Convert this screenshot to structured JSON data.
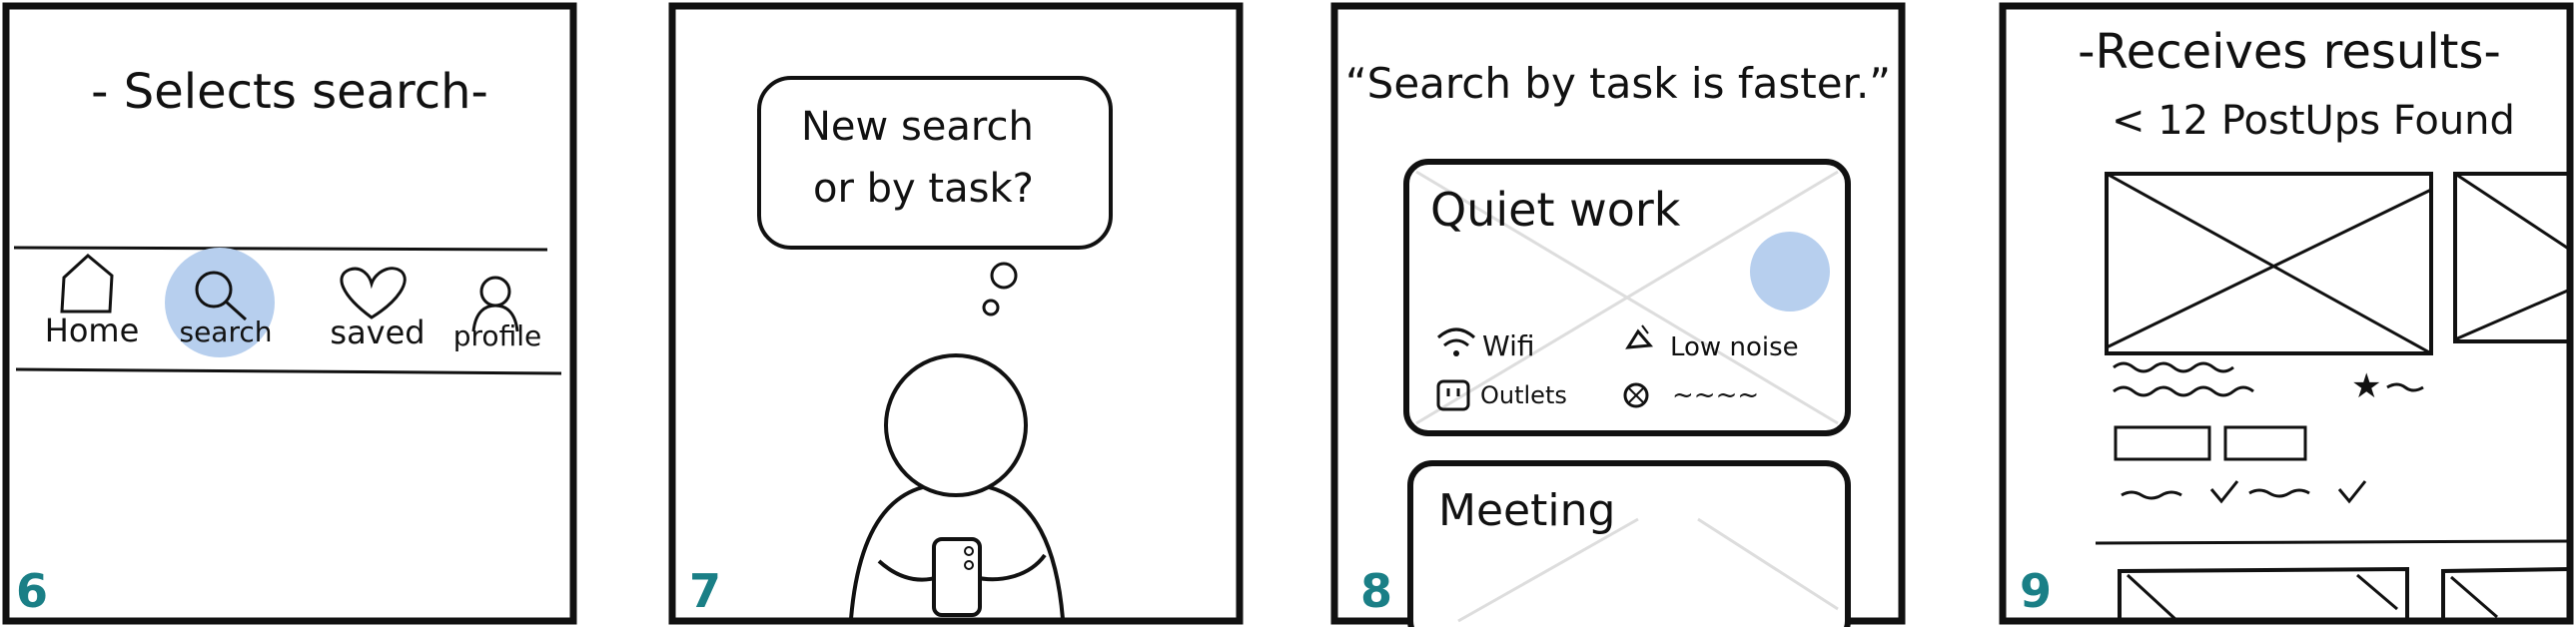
{
  "accent_colors": {
    "highlight": "#b7cfee",
    "panel_number": "#1a7f86",
    "ink": "#111111"
  },
  "panels": [
    {
      "number": "6",
      "caption": "- Selects search-",
      "nav_items": [
        {
          "label": "Home",
          "icon": "house-icon"
        },
        {
          "label": "search",
          "icon": "magnifier-icon"
        },
        {
          "label": "saved",
          "icon": "heart-icon"
        },
        {
          "label": "profile",
          "icon": "person-icon"
        }
      ]
    },
    {
      "number": "7",
      "thought_line1": "New search",
      "thought_line2": "or by task?"
    },
    {
      "number": "8",
      "caption": "“Search by task is faster.”",
      "card1_title": "Quiet work",
      "card1_feature_wifi": "Wifi",
      "card1_feature_noise": "Low noise",
      "card1_feature_outlets": "Outlets",
      "card1_feature_other": "~~~~",
      "card2_title": "Meeting"
    },
    {
      "number": "9",
      "caption": "-Receives results-",
      "results_header": "< 12 PostUps Found"
    }
  ]
}
